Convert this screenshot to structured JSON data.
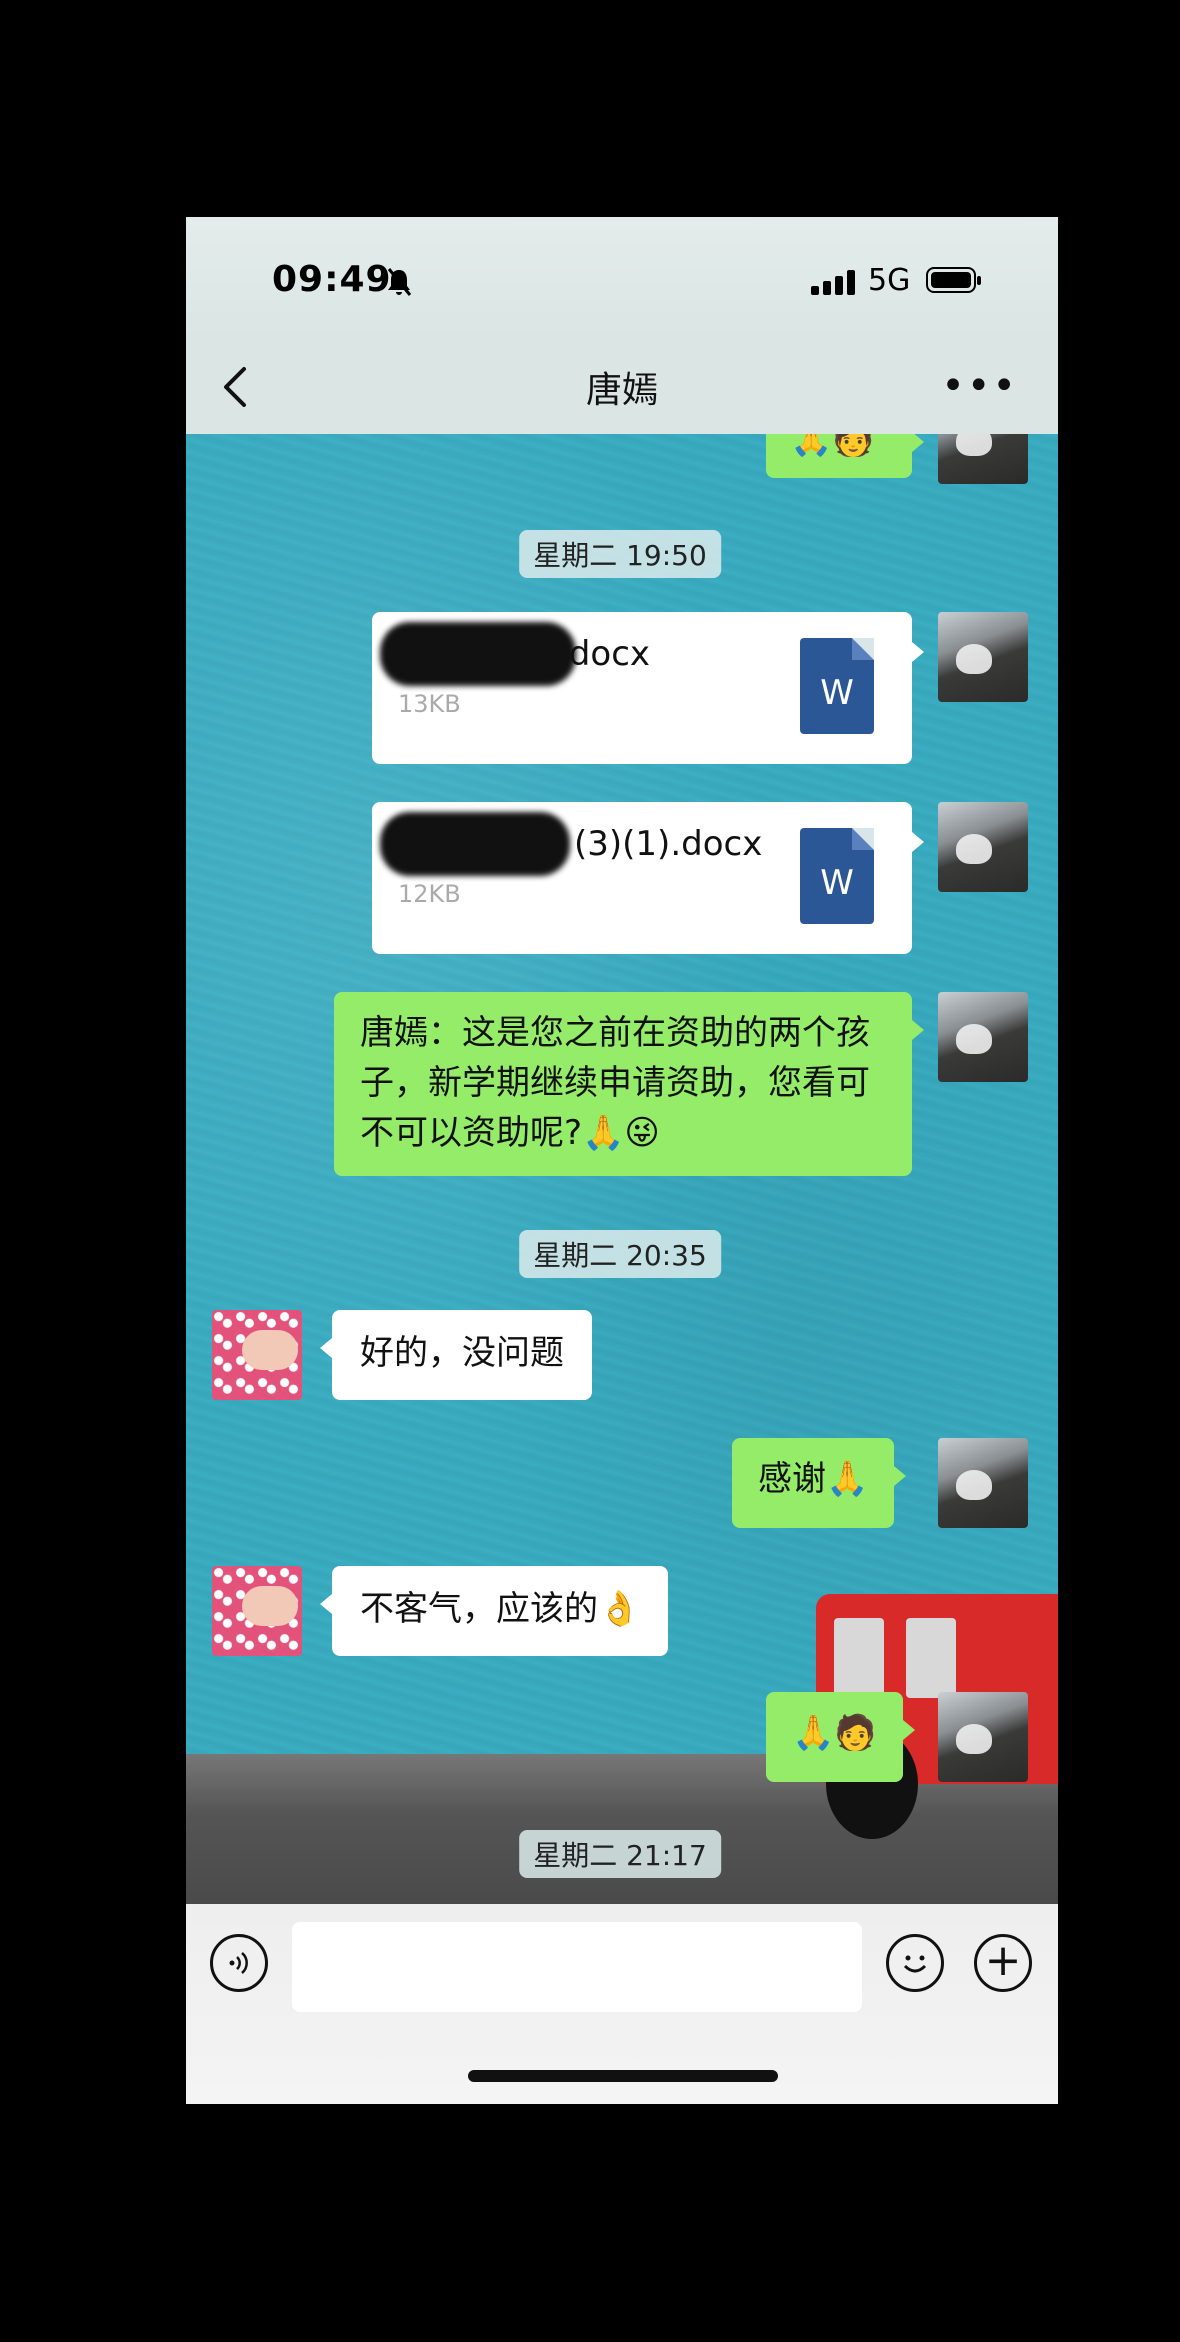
{
  "status_bar": {
    "time": "09:49",
    "network": "5G"
  },
  "nav": {
    "title": "唐嫣"
  },
  "timestamps": {
    "t1": "星期二 19:50",
    "t2": "星期二 20:35",
    "t3": "星期二 21:17"
  },
  "messages": {
    "top_partial": "🙏🧑",
    "file1": {
      "name": ".docx",
      "size": "13KB",
      "icon": "W"
    },
    "file2": {
      "name": "(3)(1).docx",
      "size": "12KB",
      "icon": "W"
    },
    "text1": "唐嫣：这是您之前在资助的两个孩子，新学期继续申请资助，您看可不可以资助呢?🙏😜",
    "reply1": "好的，没问题",
    "text2": "感谢🙏",
    "reply2": "不客气，应该的👌",
    "text3": "🙏🧑"
  },
  "colors": {
    "bubble_green": "#95ec69",
    "word_blue": "#2b5797"
  }
}
